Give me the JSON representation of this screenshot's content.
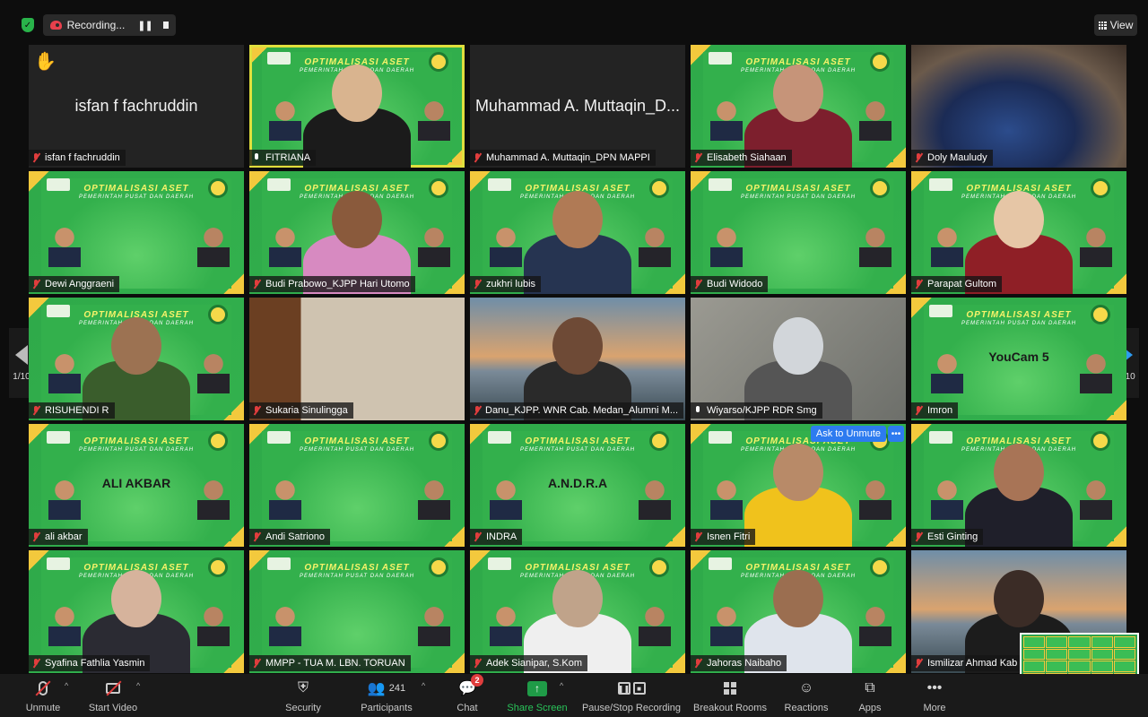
{
  "top_bar": {
    "recording_label": "Recording...",
    "pause_symbol": "❚❚",
    "view_label": "View"
  },
  "colors": {
    "accent_blue": "#2d7bf0",
    "share_green": "#29c55a",
    "muted_red": "#e03d3d",
    "active_speaker": "#e0df3d",
    "slide_green": "#32b04d",
    "slide_yellow": "#f3c93d"
  },
  "slide": {
    "title": "OPTIMALISASI ASET",
    "subtitle": "PEMERINTAH PUSAT DAN DAERAH"
  },
  "pager": {
    "page_label": "1/10"
  },
  "participants": [
    {
      "name": "isfan f fachruddin",
      "big_label": "isfan f fachruddin",
      "muted": true,
      "hand_raised": true
    },
    {
      "name": "FITRIANA",
      "muted": false,
      "active": true
    },
    {
      "name": "Muhammad A. Muttaqin_DPN MAPPI",
      "big_label": "Muhammad A. Muttaqin_D...",
      "muted": true
    },
    {
      "name": "Elisabeth Siahaan",
      "muted": true
    },
    {
      "name": "Doly Mauludy",
      "muted": true
    },
    {
      "name": "Dewi Anggraeni",
      "muted": true
    },
    {
      "name": "Budi Prabowo_KJPP Hari Utomo",
      "muted": true
    },
    {
      "name": "zukhri lubis",
      "muted": true
    },
    {
      "name": "Budi Widodo",
      "muted": true
    },
    {
      "name": "Parapat Gultom",
      "muted": true
    },
    {
      "name": "RISUHENDI R",
      "muted": true
    },
    {
      "name": "Sukaria Sinulingga",
      "muted": true
    },
    {
      "name": "Danu_KJPP. WNR Cab. Medan_Alumni M...",
      "muted": true
    },
    {
      "name": "Wiyarso/KJPP RDR Smg",
      "muted": false
    },
    {
      "name": "Imron",
      "muted": true,
      "overlay_text": "YouCam 5"
    },
    {
      "name": "ali akbar",
      "muted": true,
      "overlay_text": "ALI AKBAR"
    },
    {
      "name": "Andi Satriono",
      "muted": true
    },
    {
      "name": "INDRA",
      "muted": true,
      "overlay_text": "A.N.D.R.A"
    },
    {
      "name": "Isnen Fitri",
      "muted": true,
      "ask_unmute": "Ask to Unmute",
      "more": "•••"
    },
    {
      "name": "Esti Ginting",
      "muted": true
    },
    {
      "name": "Syafina Fathlia Yasmin",
      "muted": true
    },
    {
      "name": "MMPP - TUA M. LBN. TORUAN",
      "muted": true
    },
    {
      "name": "Adek Sianipar, S.Kom",
      "muted": true
    },
    {
      "name": "Jahoras Naibaho",
      "muted": true
    },
    {
      "name": "Ismilizar Ahmad Kab",
      "muted": true
    }
  ],
  "toolbar": {
    "unmute": "Unmute",
    "start_video": "Start Video",
    "security": "Security",
    "participants": "Participants",
    "participants_count": "241",
    "chat": "Chat",
    "chat_badge": "2",
    "share_screen": "Share Screen",
    "pause_stop_recording": "Pause/Stop Recording",
    "breakout_rooms": "Breakout Rooms",
    "reactions": "Reactions",
    "apps": "Apps",
    "more": "More",
    "more_dots": "•••",
    "caret": "^"
  }
}
